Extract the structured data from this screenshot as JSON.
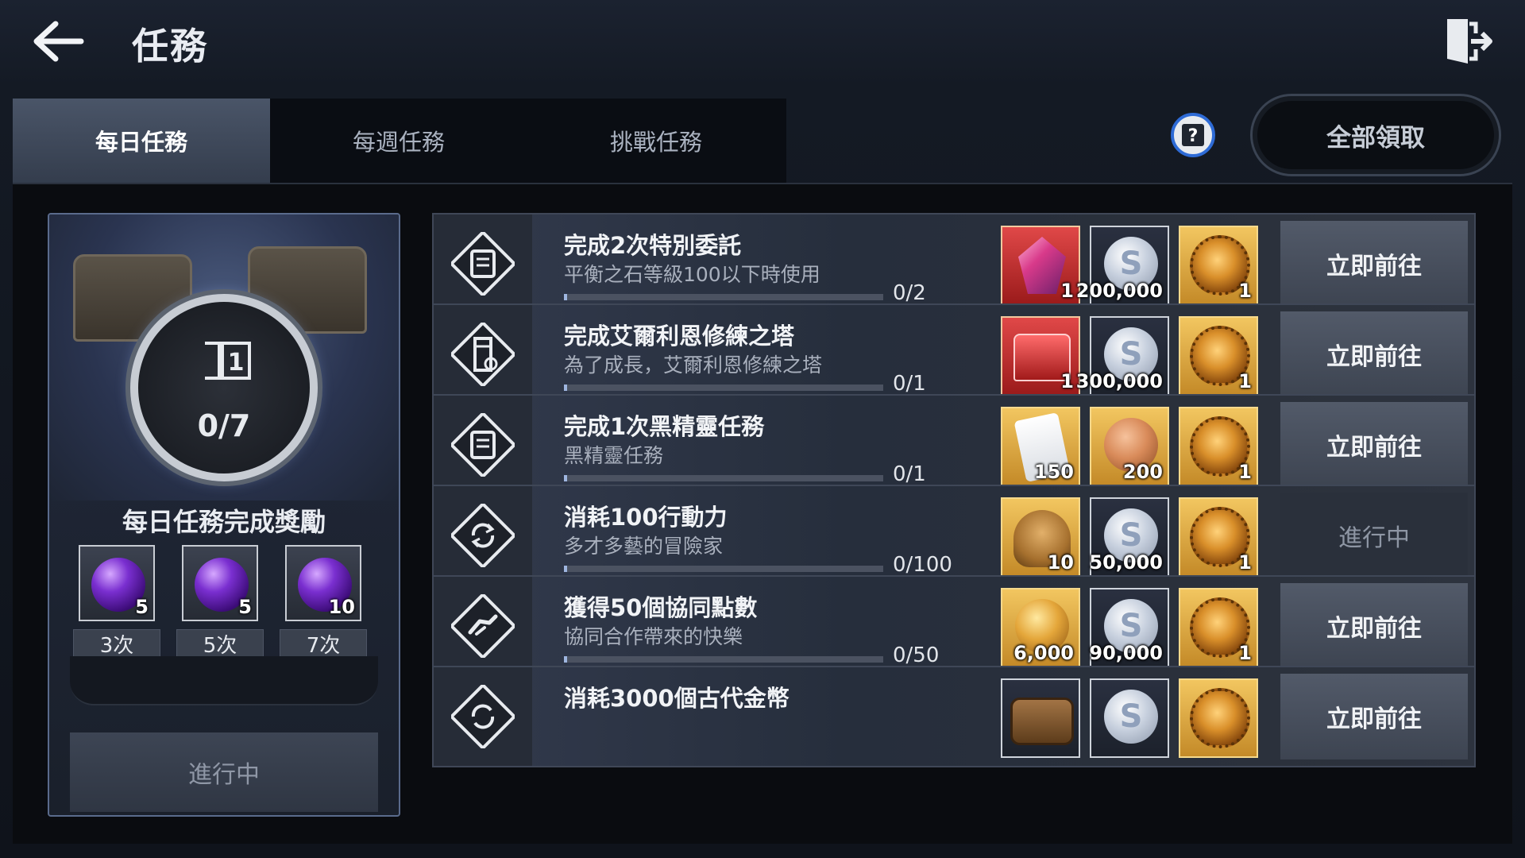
{
  "header": {
    "title": "任務"
  },
  "tabs": [
    {
      "label": "每日任務",
      "active": true
    },
    {
      "label": "每週任務",
      "active": false
    },
    {
      "label": "挑戰任務",
      "active": false
    }
  ],
  "toolbar": {
    "claim_all_label": "全部領取",
    "help_icon": "help-book-icon",
    "exit_icon": "exit-icon",
    "back_icon": "back-arrow-icon"
  },
  "daily_reward": {
    "progress_text": "0/7",
    "progress": {
      "done": 0,
      "total": 7
    },
    "title": "每日任務完成獎勵",
    "milestones": [
      {
        "qty": "5",
        "label": "3次"
      },
      {
        "qty": "5",
        "label": "5次"
      },
      {
        "qty": "10",
        "label": "7次"
      }
    ],
    "status_label": "進行中"
  },
  "quests": [
    {
      "title": "完成2次特別委託",
      "desc": "平衡之石等級100以下時使用",
      "count": "0/2",
      "progress": 0,
      "rewards": [
        {
          "type": "crystal",
          "qty": "1"
        },
        {
          "type": "silver",
          "qty": "200,000"
        },
        {
          "type": "gear",
          "qty": "1"
        }
      ],
      "button": "立即前往",
      "status": "go"
    },
    {
      "title": "完成艾爾利恩修練之塔",
      "desc": "為了成長，艾爾利恩修練之塔",
      "count": "0/1",
      "progress": 0,
      "rewards": [
        {
          "type": "red-chest",
          "qty": "1"
        },
        {
          "type": "silver",
          "qty": "300,000"
        },
        {
          "type": "gear",
          "qty": "1"
        }
      ],
      "button": "立即前往",
      "status": "go"
    },
    {
      "title": "完成1次黑精靈任務",
      "desc": "黑精靈任務",
      "count": "0/1",
      "progress": 0,
      "rewards": [
        {
          "type": "scroll",
          "qty": "150"
        },
        {
          "type": "bronze",
          "qty": "200"
        },
        {
          "type": "gear",
          "qty": "1"
        }
      ],
      "button": "立即前往",
      "status": "go"
    },
    {
      "title": "消耗100行動力",
      "desc": "多才多藝的冒險家",
      "count": "0/100",
      "progress": 0,
      "rewards": [
        {
          "type": "bag",
          "qty": "10"
        },
        {
          "type": "silver",
          "qty": "50,000"
        },
        {
          "type": "gear",
          "qty": "1"
        }
      ],
      "button": "進行中",
      "status": "pending"
    },
    {
      "title": "獲得50個協同點數",
      "desc": "協同合作帶來的快樂",
      "count": "0/50",
      "progress": 0,
      "rewards": [
        {
          "type": "gold",
          "qty": "6,000"
        },
        {
          "type": "silver",
          "qty": "90,000"
        },
        {
          "type": "gear",
          "qty": "1"
        }
      ],
      "button": "立即前往",
      "status": "go"
    },
    {
      "title": "消耗3000個古代金幣",
      "desc": "",
      "count": "",
      "progress": 0,
      "rewards": [
        {
          "type": "barrel",
          "qty": ""
        },
        {
          "type": "silver",
          "qty": ""
        },
        {
          "type": "gear",
          "qty": ""
        }
      ],
      "button": "立即前往",
      "status": "go"
    }
  ],
  "colors": {
    "accent_blue": "#2e6bd6",
    "panel": "#0a0c10",
    "button": "#525a69"
  }
}
